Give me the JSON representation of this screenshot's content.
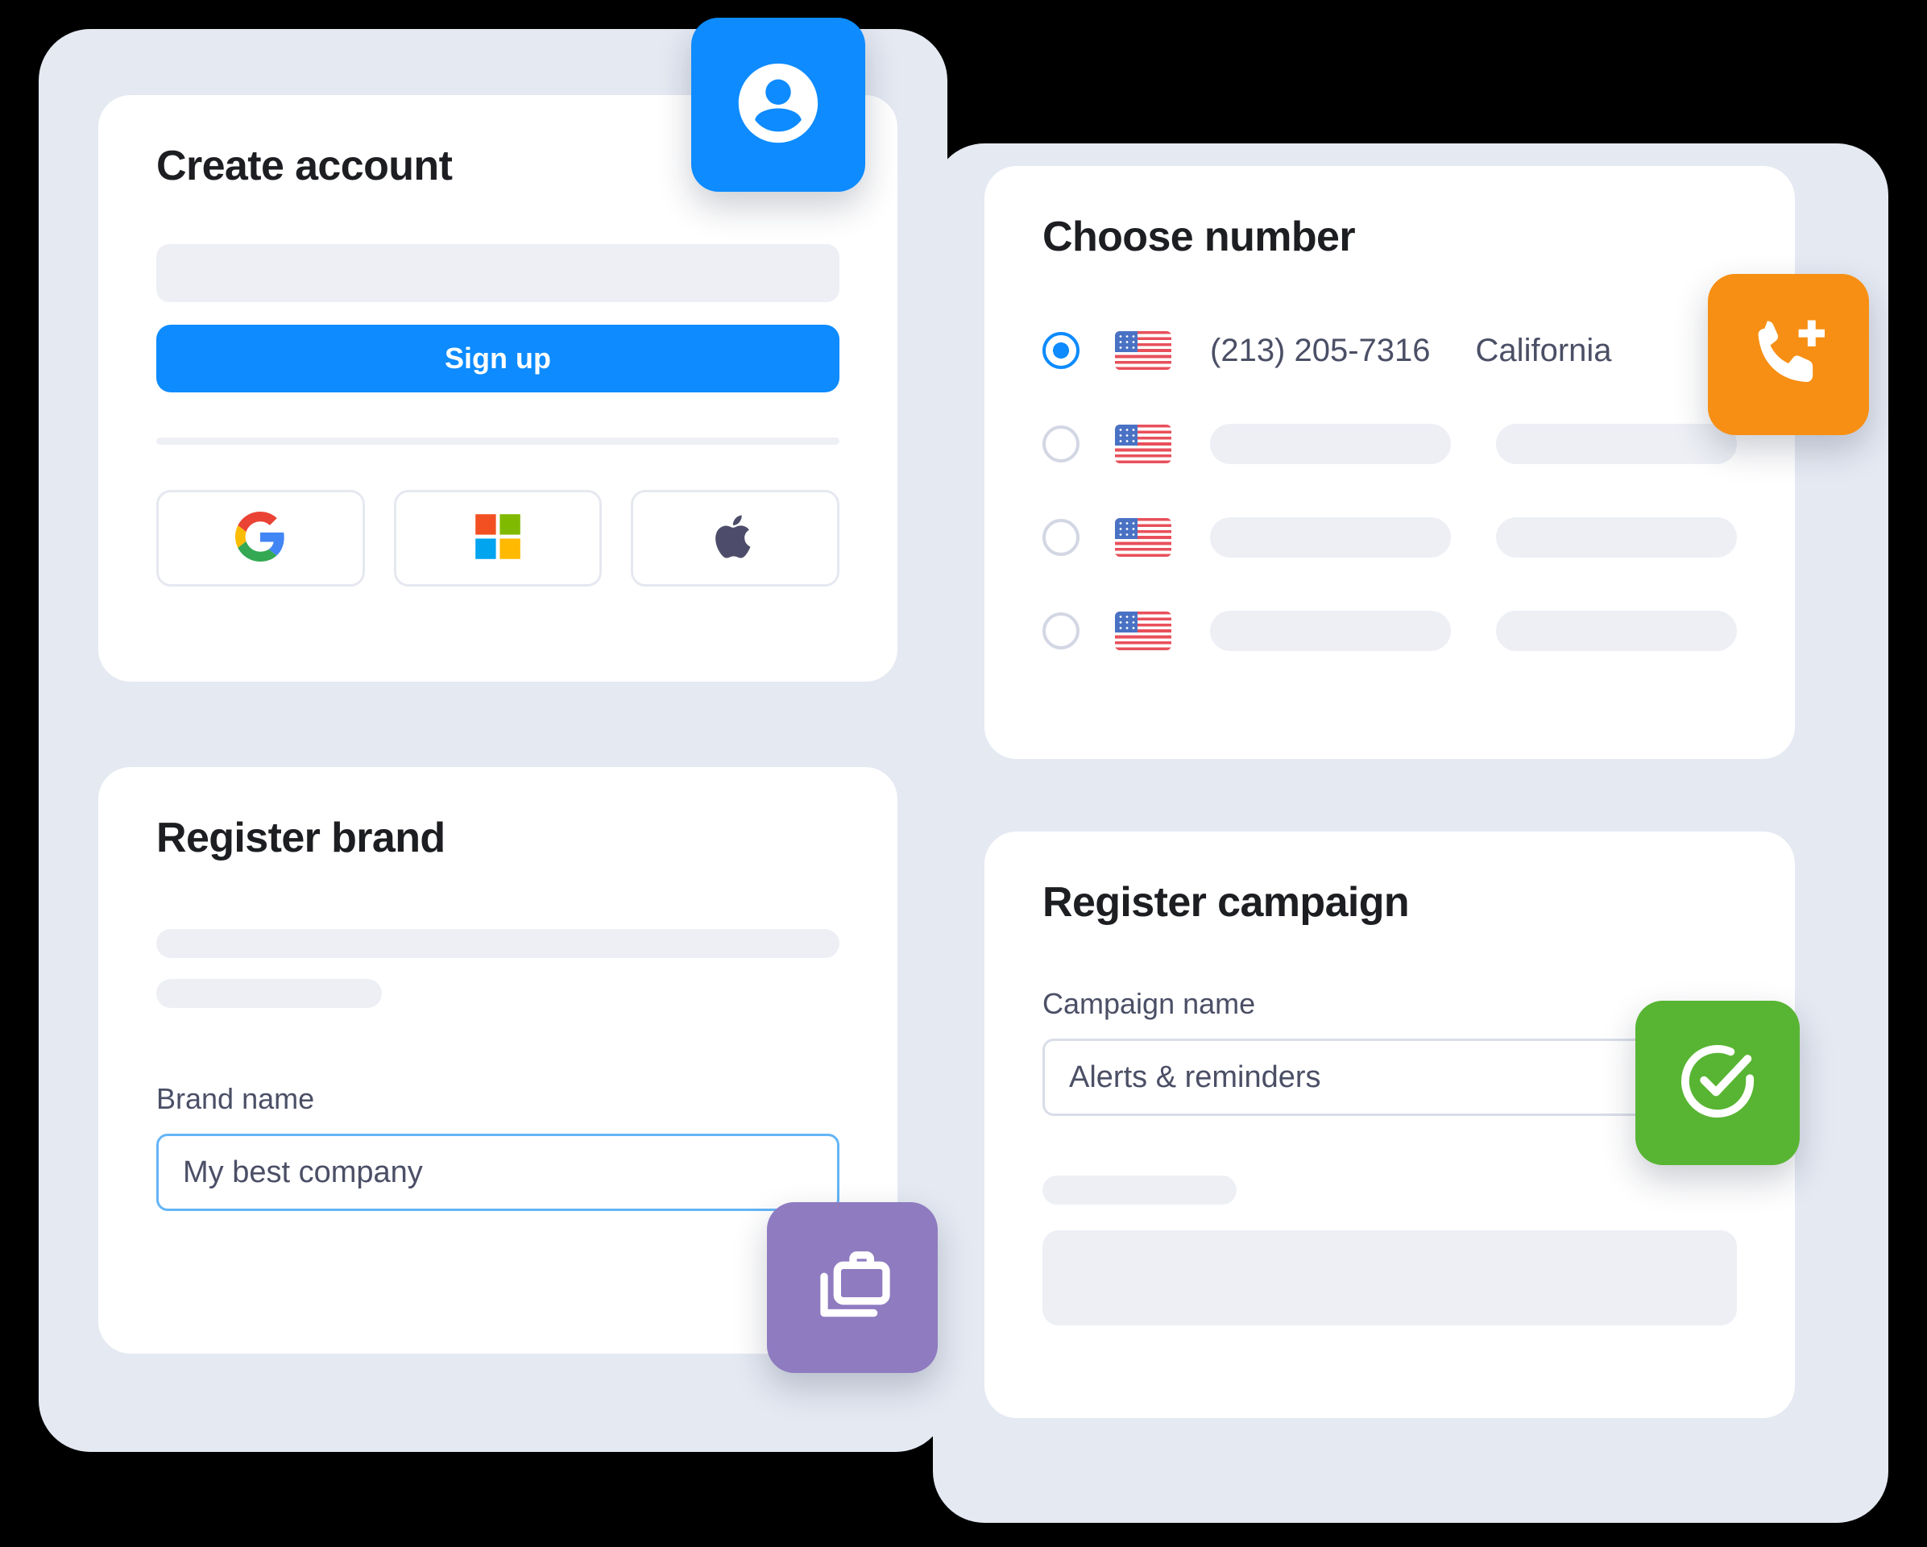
{
  "theme": {
    "background": "#000000",
    "shell": "#e4e9f2",
    "card": "#ffffff",
    "skeleton": "#edeff5",
    "primary": "#0d8bff",
    "orange": "#f78f14",
    "purple": "#8f7bc0",
    "green": "#58b533",
    "text_dark": "#1c1e21",
    "text_muted": "#4b4f66"
  },
  "create_account": {
    "title": "Create account",
    "email_placeholder": "",
    "signup_label": "Sign up",
    "social_buttons": [
      {
        "name": "google",
        "icon": "google-icon"
      },
      {
        "name": "microsoft",
        "icon": "microsoft-icon"
      },
      {
        "name": "apple",
        "icon": "apple-icon"
      }
    ]
  },
  "choose_number": {
    "title": "Choose number",
    "rows": [
      {
        "selected": true,
        "flag": "us-flag-icon",
        "number": "(213) 205-7316",
        "region": "California"
      },
      {
        "selected": false,
        "flag": "us-flag-icon",
        "number": "",
        "region": ""
      },
      {
        "selected": false,
        "flag": "us-flag-icon",
        "number": "",
        "region": ""
      },
      {
        "selected": false,
        "flag": "us-flag-icon",
        "number": "",
        "region": ""
      }
    ]
  },
  "register_brand": {
    "title": "Register brand",
    "brand_name_label": "Brand name",
    "brand_name_value": "My best company"
  },
  "register_campaign": {
    "title": "Register campaign",
    "campaign_name_label": "Campaign name",
    "campaign_name_value": "Alerts & reminders"
  },
  "badges": [
    {
      "name": "account-badge",
      "icon": "person-circle-icon",
      "color": "#0d8bff"
    },
    {
      "name": "phone-badge",
      "icon": "phone-plus-icon",
      "color": "#f78f14"
    },
    {
      "name": "brand-badge",
      "icon": "briefcase-icon",
      "color": "#8f7bc0"
    },
    {
      "name": "approved-badge",
      "icon": "check-circle-icon",
      "color": "#58b533"
    }
  ]
}
